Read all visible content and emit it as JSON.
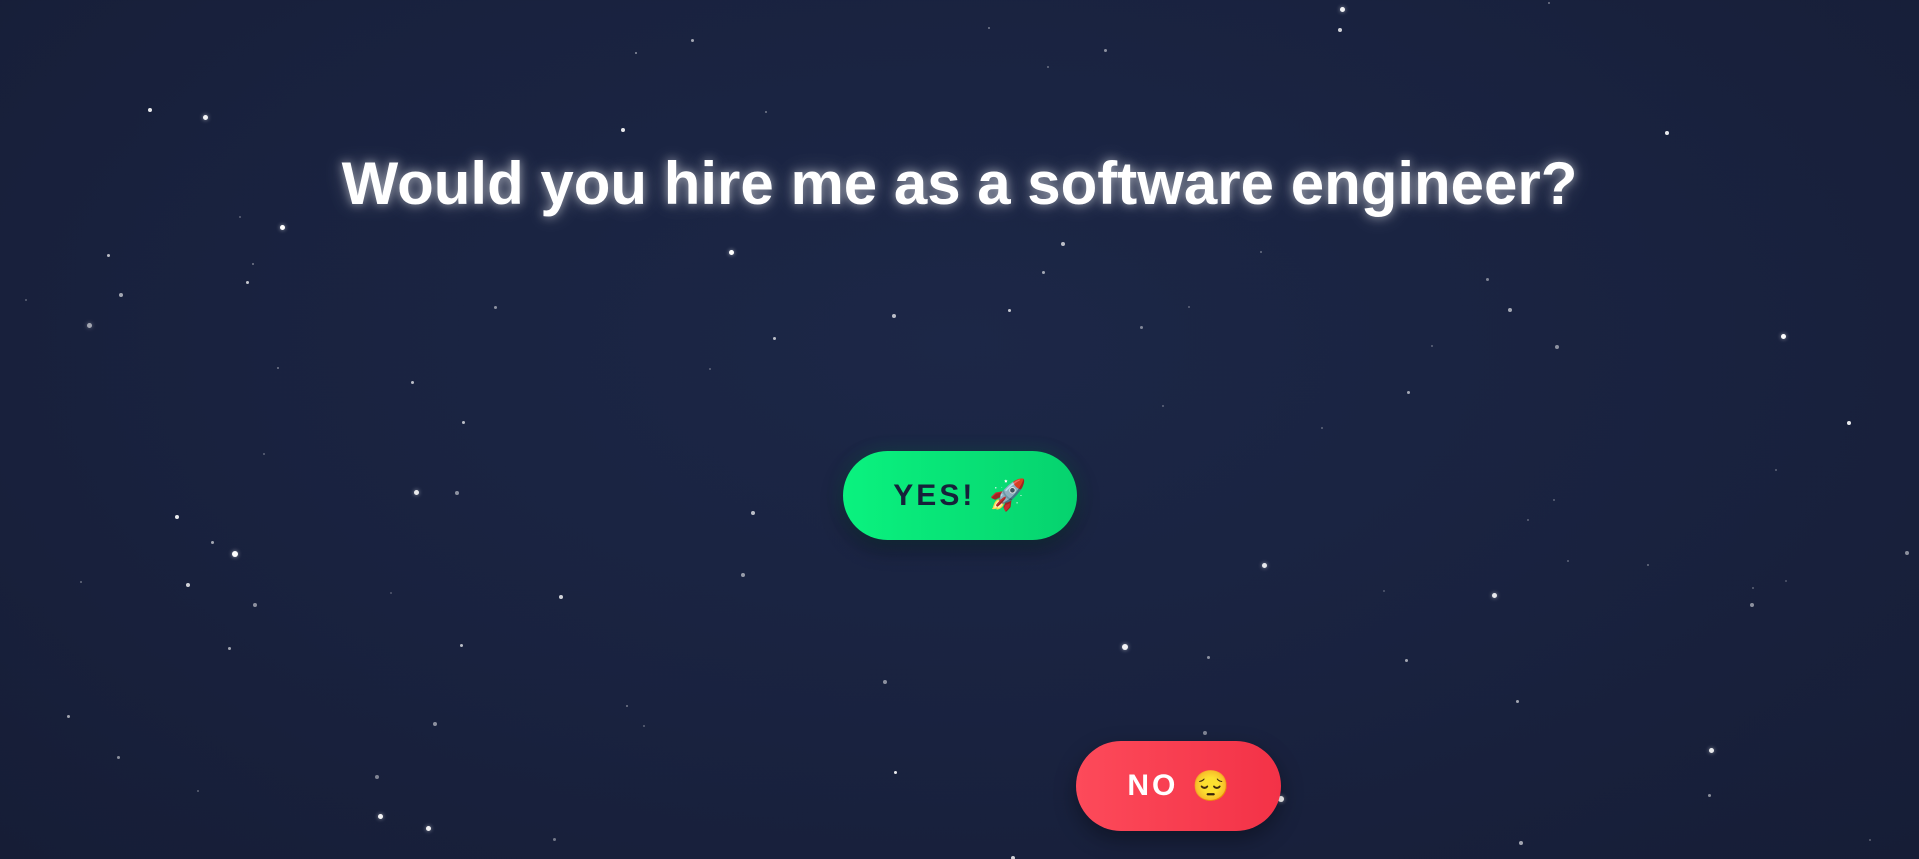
{
  "page": {
    "headline": "Would you hire me as a software engineer?",
    "background_color": "#19223f"
  },
  "buttons": {
    "yes": {
      "label": "YES!",
      "emoji": "🚀",
      "icon": "rocket-icon",
      "color": "#0af27f",
      "text_color": "#16213a"
    },
    "no": {
      "label": "NO",
      "emoji": "😔",
      "icon": "pensive-face-icon",
      "color": "#fd4a5a",
      "text_color": "#ffffff"
    }
  }
}
